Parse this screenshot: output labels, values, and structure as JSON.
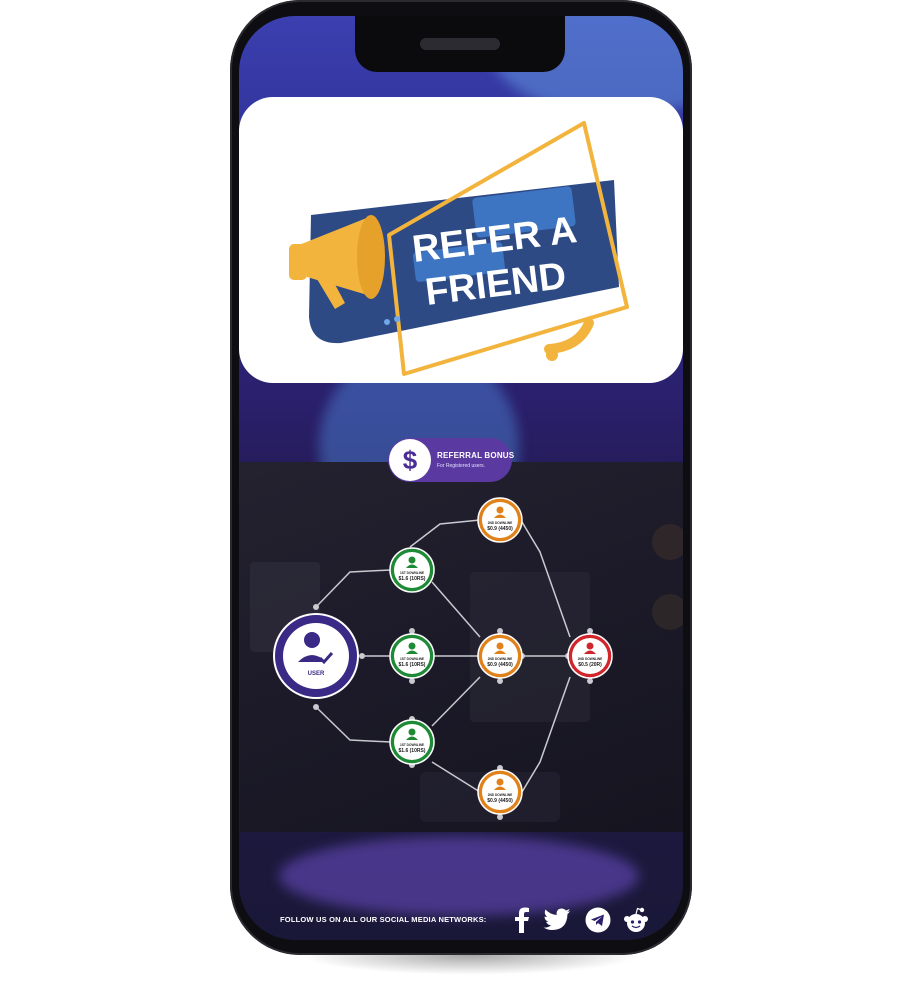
{
  "banner": {
    "line1": "REFER A",
    "line2": "FRIEND"
  },
  "bonus": {
    "symbol": "$",
    "title": "REFERRAL BONUS",
    "subtitle": "For Registered users."
  },
  "tree": {
    "user_label": "USER",
    "first_downline": {
      "title": "1ST DOWNLINE",
      "amount": "$1.6",
      "tag": "(10RS)"
    },
    "second_downline": {
      "title": "2ND DOWNLINE",
      "amount": "$0.9",
      "tag": "(4450)"
    },
    "third_downline": {
      "title": "2ND DOWNLINE",
      "amount": "$0.5",
      "tag": "(20R)"
    }
  },
  "footer": {
    "text": "FOLLOW US ON ALL OUR SOCIAL MEDIA NETWORKS:",
    "icons": [
      "facebook-icon",
      "twitter-icon",
      "telegram-icon",
      "reddit-icon"
    ]
  },
  "colors": {
    "user": "#3a2a85",
    "first": "#1f8a35",
    "second": "#e0821c",
    "third": "#d0262b",
    "banner_navy": "#2d4a85",
    "banner_yellow": "#f2b43c"
  }
}
